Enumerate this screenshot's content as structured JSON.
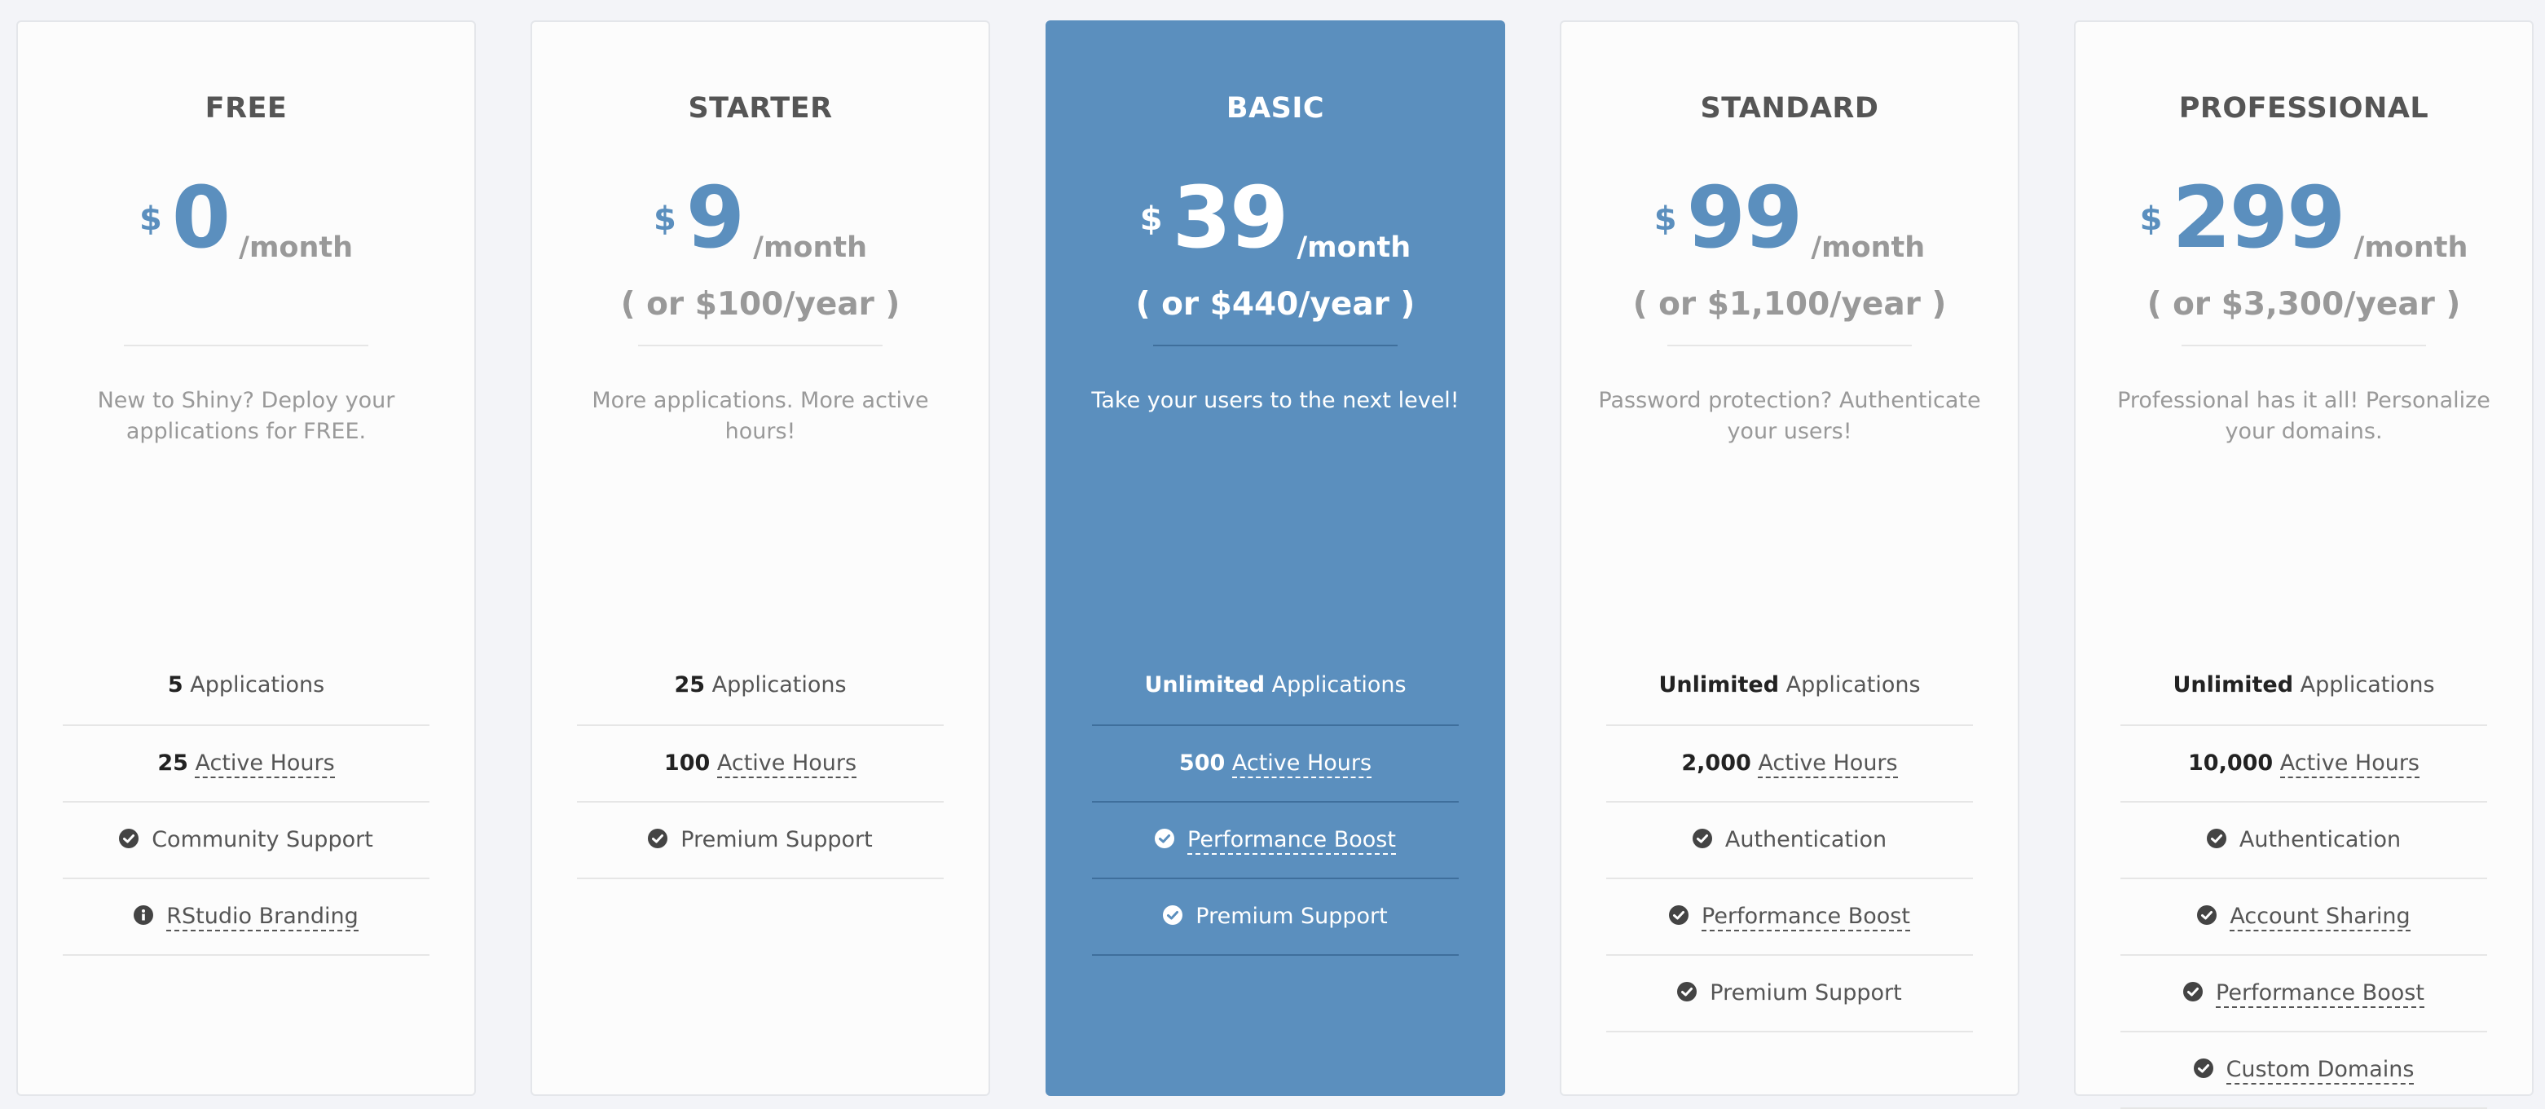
{
  "plans": [
    {
      "name": "FREE",
      "currency": "$",
      "amount": "0",
      "period": "/month",
      "yearly": "",
      "description": "New to Shiny? Deploy your applications for FREE.",
      "features": [
        {
          "strong": "5",
          "text": "Applications",
          "dashed": false,
          "icon": "none"
        },
        {
          "strong": "25",
          "text": "Active Hours",
          "dashed": true,
          "icon": "none"
        },
        {
          "strong": "",
          "text": "Community Support",
          "dashed": false,
          "icon": "check-circle-icon"
        },
        {
          "strong": "",
          "text": "RStudio Branding",
          "dashed": true,
          "icon": "info-circle-icon"
        }
      ]
    },
    {
      "name": "STARTER",
      "currency": "$",
      "amount": "9",
      "period": "/month",
      "yearly": "( or $100/year )",
      "description": "More applications. More active hours!",
      "features": [
        {
          "strong": "25",
          "text": "Applications",
          "dashed": false,
          "icon": "none"
        },
        {
          "strong": "100",
          "text": "Active Hours",
          "dashed": true,
          "icon": "none"
        },
        {
          "strong": "",
          "text": "Premium Support",
          "dashed": false,
          "icon": "check-circle-icon"
        }
      ]
    },
    {
      "name": "BASIC",
      "currency": "$",
      "amount": "39",
      "period": "/month",
      "yearly": "( or $440/year )",
      "description": "Take your users to the next level!",
      "highlight": true,
      "features": [
        {
          "strong": "Unlimited",
          "text": "Applications",
          "dashed": false,
          "icon": "none"
        },
        {
          "strong": "500",
          "text": "Active Hours",
          "dashed": true,
          "icon": "none"
        },
        {
          "strong": "",
          "text": "Performance Boost",
          "dashed": true,
          "icon": "check-circle-icon"
        },
        {
          "strong": "",
          "text": "Premium Support",
          "dashed": false,
          "icon": "check-circle-icon"
        }
      ]
    },
    {
      "name": "STANDARD",
      "currency": "$",
      "amount": "99",
      "period": "/month",
      "yearly": "( or $1,100/year )",
      "description": "Password protection? Authenticate your users!",
      "features": [
        {
          "strong": "Unlimited",
          "text": "Applications",
          "dashed": false,
          "icon": "none"
        },
        {
          "strong": "2,000",
          "text": "Active Hours",
          "dashed": true,
          "icon": "none"
        },
        {
          "strong": "",
          "text": "Authentication",
          "dashed": false,
          "icon": "check-circle-icon"
        },
        {
          "strong": "",
          "text": "Performance Boost",
          "dashed": true,
          "icon": "check-circle-icon"
        },
        {
          "strong": "",
          "text": "Premium Support",
          "dashed": false,
          "icon": "check-circle-icon"
        }
      ]
    },
    {
      "name": "PROFESSIONAL",
      "currency": "$",
      "amount": "299",
      "period": "/month",
      "yearly": "( or $3,300/year )",
      "description": "Professional has it all! Personalize your domains.",
      "features": [
        {
          "strong": "Unlimited",
          "text": "Applications",
          "dashed": false,
          "icon": "none"
        },
        {
          "strong": "10,000",
          "text": "Active Hours",
          "dashed": true,
          "icon": "none"
        },
        {
          "strong": "",
          "text": "Authentication",
          "dashed": false,
          "icon": "check-circle-icon"
        },
        {
          "strong": "",
          "text": "Account Sharing",
          "dashed": true,
          "icon": "check-circle-icon"
        },
        {
          "strong": "",
          "text": "Performance Boost",
          "dashed": true,
          "icon": "check-circle-icon"
        },
        {
          "strong": "",
          "text": "Custom Domains",
          "dashed": true,
          "icon": "check-circle-icon"
        }
      ]
    }
  ]
}
